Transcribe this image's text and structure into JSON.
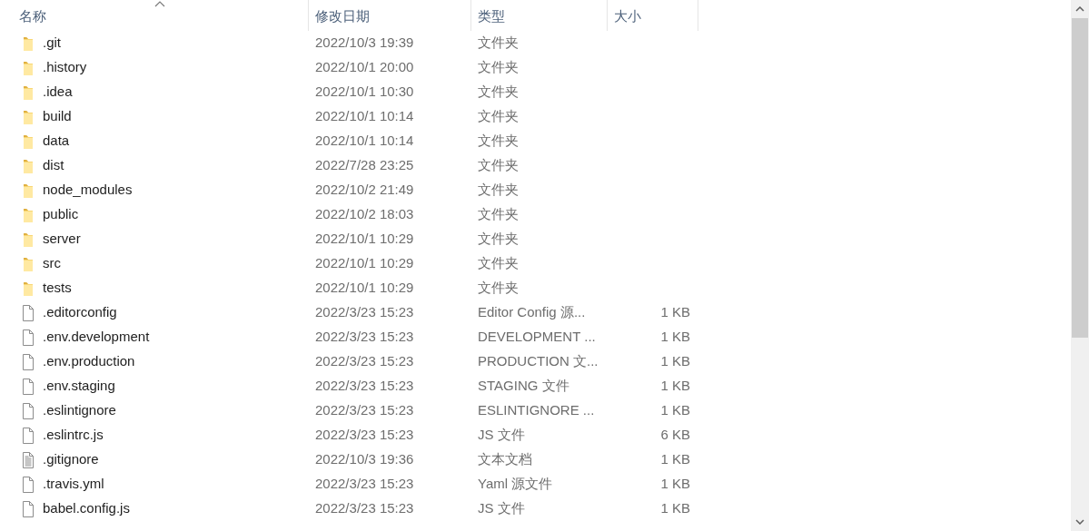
{
  "columns": [
    {
      "label": "名称",
      "sorted": true
    },
    {
      "label": "修改日期",
      "sorted": false
    },
    {
      "label": "类型",
      "sorted": false
    },
    {
      "label": "大小",
      "sorted": false
    }
  ],
  "rows": [
    {
      "name": ".git",
      "modified": "2022/10/3 19:39",
      "type": "文件夹",
      "kind": "folder"
    },
    {
      "name": ".history",
      "modified": "2022/10/1 20:00",
      "type": "文件夹",
      "kind": "folder"
    },
    {
      "name": ".idea",
      "modified": "2022/10/1 10:30",
      "type": "文件夹",
      "kind": "folder"
    },
    {
      "name": "build",
      "modified": "2022/10/1 10:14",
      "type": "文件夹",
      "kind": "folder"
    },
    {
      "name": "data",
      "modified": "2022/10/1 10:14",
      "type": "文件夹",
      "kind": "folder"
    },
    {
      "name": "dist",
      "modified": "2022/7/28 23:25",
      "type": "文件夹",
      "kind": "folder"
    },
    {
      "name": "node_modules",
      "modified": "2022/10/2 21:49",
      "type": "文件夹",
      "kind": "folder"
    },
    {
      "name": "public",
      "modified": "2022/10/2 18:03",
      "type": "文件夹",
      "kind": "folder"
    },
    {
      "name": "server",
      "modified": "2022/10/1 10:29",
      "type": "文件夹",
      "kind": "folder"
    },
    {
      "name": "src",
      "modified": "2022/10/1 10:29",
      "type": "文件夹",
      "kind": "folder"
    },
    {
      "name": "tests",
      "modified": "2022/10/1 10:29",
      "type": "文件夹",
      "kind": "folder"
    },
    {
      "name": ".editorconfig",
      "modified": "2022/3/23 15:23",
      "type": "Editor Config 源...",
      "size": "1 KB",
      "kind": "file"
    },
    {
      "name": ".env.development",
      "modified": "2022/3/23 15:23",
      "type": "DEVELOPMENT ...",
      "size": "1 KB",
      "kind": "file"
    },
    {
      "name": ".env.production",
      "modified": "2022/3/23 15:23",
      "type": "PRODUCTION 文...",
      "size": "1 KB",
      "kind": "file"
    },
    {
      "name": ".env.staging",
      "modified": "2022/3/23 15:23",
      "type": "STAGING 文件",
      "size": "1 KB",
      "kind": "file"
    },
    {
      "name": ".eslintignore",
      "modified": "2022/3/23 15:23",
      "type": "ESLINTIGNORE ...",
      "size": "1 KB",
      "kind": "file"
    },
    {
      "name": ".eslintrc.js",
      "modified": "2022/3/23 15:23",
      "type": "JS 文件",
      "size": "6 KB",
      "kind": "file"
    },
    {
      "name": ".gitignore",
      "modified": "2022/10/3 19:36",
      "type": "文本文档",
      "size": "1 KB",
      "kind": "text"
    },
    {
      "name": ".travis.yml",
      "modified": "2022/3/23 15:23",
      "type": "Yaml 源文件",
      "size": "1 KB",
      "kind": "file"
    },
    {
      "name": "babel.config.js",
      "modified": "2022/3/23 15:23",
      "type": "JS 文件",
      "size": "1 KB",
      "kind": "file"
    }
  ]
}
